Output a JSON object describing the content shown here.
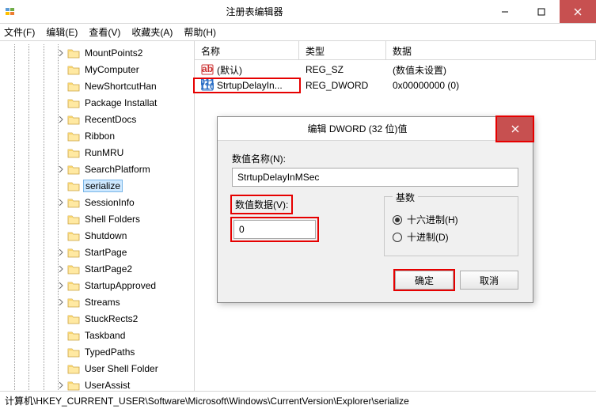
{
  "window": {
    "title": "注册表编辑器",
    "menu": [
      "文件(F)",
      "编辑(E)",
      "查看(V)",
      "收藏夹(A)",
      "帮助(H)"
    ]
  },
  "tree": {
    "items": [
      {
        "label": "MountPoints2",
        "expander": "closed"
      },
      {
        "label": "MyComputer",
        "expander": "none"
      },
      {
        "label": "NewShortcutHan",
        "expander": "none"
      },
      {
        "label": "Package Installat",
        "expander": "none"
      },
      {
        "label": "RecentDocs",
        "expander": "closed"
      },
      {
        "label": "Ribbon",
        "expander": "none"
      },
      {
        "label": "RunMRU",
        "expander": "none"
      },
      {
        "label": "SearchPlatform",
        "expander": "closed"
      },
      {
        "label": "serialize",
        "expander": "none",
        "selected": true
      },
      {
        "label": "SessionInfo",
        "expander": "closed"
      },
      {
        "label": "Shell Folders",
        "expander": "none"
      },
      {
        "label": "Shutdown",
        "expander": "none"
      },
      {
        "label": "StartPage",
        "expander": "closed"
      },
      {
        "label": "StartPage2",
        "expander": "closed"
      },
      {
        "label": "StartupApproved",
        "expander": "closed"
      },
      {
        "label": "Streams",
        "expander": "closed"
      },
      {
        "label": "StuckRects2",
        "expander": "none"
      },
      {
        "label": "Taskband",
        "expander": "none"
      },
      {
        "label": "TypedPaths",
        "expander": "none"
      },
      {
        "label": "User Shell Folder",
        "expander": "none"
      },
      {
        "label": "UserAssist",
        "expander": "closed"
      }
    ]
  },
  "list": {
    "headers": {
      "name": "名称",
      "type": "类型",
      "data": "数据"
    },
    "rows": [
      {
        "icon": "string",
        "name": "(默认)",
        "type": "REG_SZ",
        "data": "(数值未设置)",
        "highlight": false
      },
      {
        "icon": "dword",
        "name": "StrtupDelayIn...",
        "type": "REG_DWORD",
        "data": "0x00000000 (0)",
        "highlight": true
      }
    ]
  },
  "statusbar": "计算机\\HKEY_CURRENT_USER\\Software\\Microsoft\\Windows\\CurrentVersion\\Explorer\\serialize",
  "dialog": {
    "title": "编辑 DWORD (32 位)值",
    "name_label": "数值名称(N):",
    "name_value": "StrtupDelayInMSec",
    "data_label": "数值数据(V):",
    "data_value": "0",
    "base_label": "基数",
    "radio_hex": "十六进制(H)",
    "radio_dec": "十进制(D)",
    "ok": "确定",
    "cancel": "取消"
  }
}
